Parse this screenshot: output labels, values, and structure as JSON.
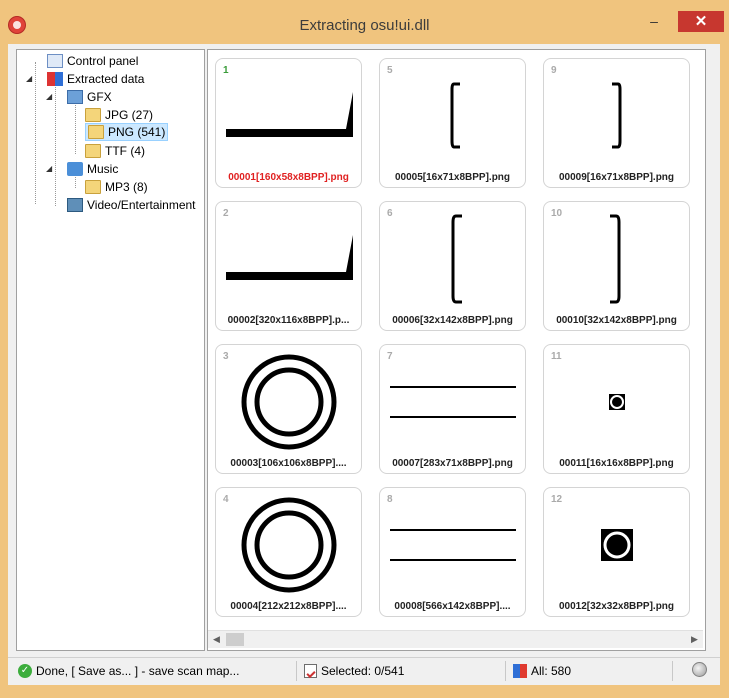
{
  "window": {
    "title": "Extracting osu!ui.dll",
    "close_glyph": "✕",
    "min_glyph": "–",
    "max_glyph": "▢"
  },
  "tree": {
    "items": [
      {
        "label": "Control panel",
        "icon": "control-panel-icon"
      },
      {
        "label": "Extracted data",
        "icon": "extracted-data-icon"
      },
      {
        "label": "GFX",
        "icon": "gfx-icon"
      },
      {
        "label": "JPG (27)",
        "icon": "folder-icon"
      },
      {
        "label": "PNG (541)",
        "icon": "folder-icon",
        "selected": true
      },
      {
        "label": "TTF (4)",
        "icon": "folder-icon"
      },
      {
        "label": "Music",
        "icon": "music-icon"
      },
      {
        "label": "MP3 (8)",
        "icon": "folder-icon"
      },
      {
        "label": "Video/Entertainment",
        "icon": "video-icon"
      }
    ]
  },
  "thumbnails": [
    {
      "num": "1",
      "caption": "00001[160x58x8BPP].png",
      "highlight": true
    },
    {
      "num": "5",
      "caption": "00005[16x71x8BPP].png"
    },
    {
      "num": "9",
      "caption": "00009[16x71x8BPP].png"
    },
    {
      "num": "2",
      "caption": "00002[320x116x8BPP].p..."
    },
    {
      "num": "6",
      "caption": "00006[32x142x8BPP].png"
    },
    {
      "num": "10",
      "caption": "00010[32x142x8BPP].png"
    },
    {
      "num": "3",
      "caption": "00003[106x106x8BPP]...."
    },
    {
      "num": "7",
      "caption": "00007[283x71x8BPP].png"
    },
    {
      "num": "11",
      "caption": "00011[16x16x8BPP].png"
    },
    {
      "num": "4",
      "caption": "00004[212x212x8BPP]...."
    },
    {
      "num": "8",
      "caption": "00008[566x142x8BPP]...."
    },
    {
      "num": "12",
      "caption": "00012[32x32x8BPP].png"
    }
  ],
  "statusbar": {
    "done_text": "Done, [ Save as... ] - save scan map...",
    "selected_text": "Selected: 0/541",
    "all_text": "All: 580"
  },
  "colors": {
    "accent": "#f0c47e",
    "close": "#c7372f",
    "selection": "#cce8ff",
    "highlight_caption": "#e02020"
  }
}
